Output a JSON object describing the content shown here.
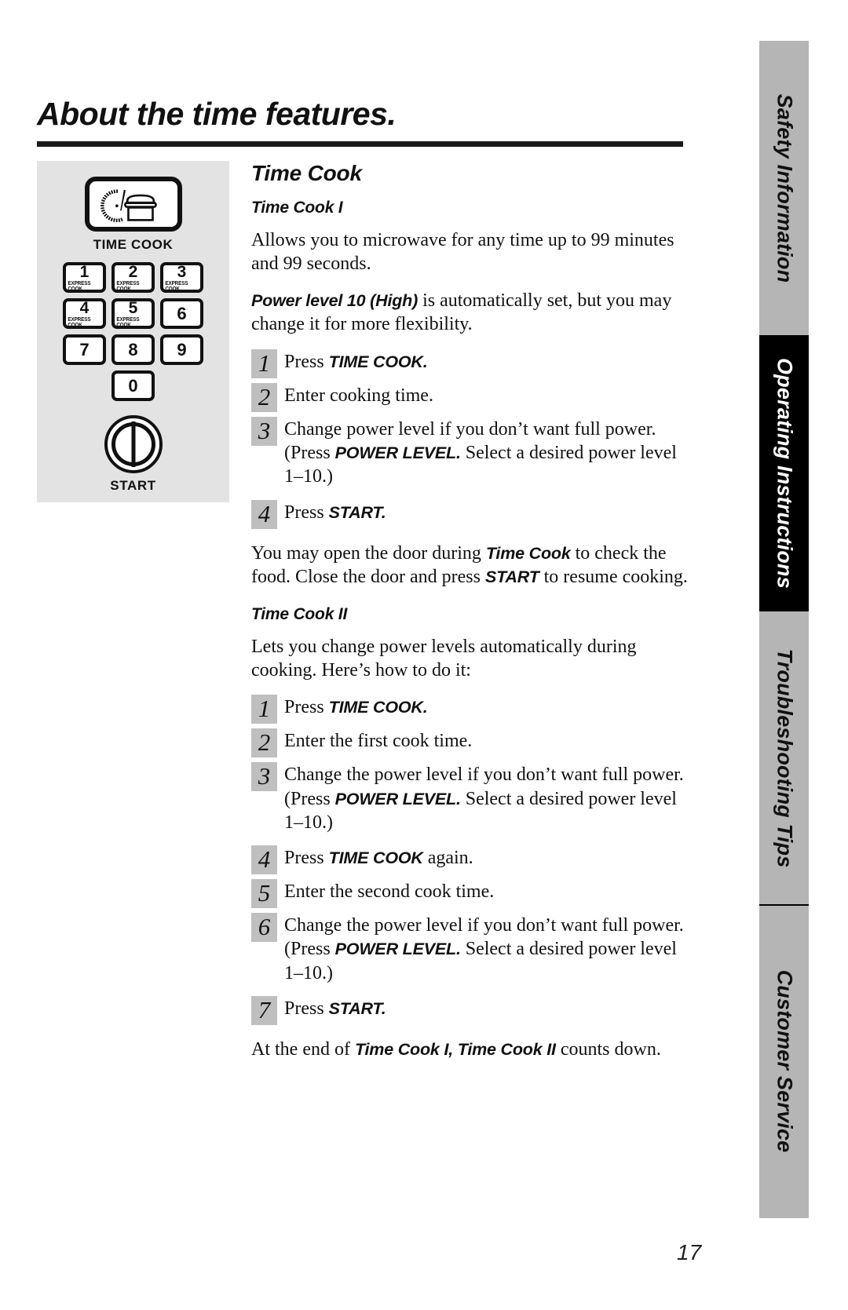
{
  "page": {
    "title": "About the time features.",
    "number": "17"
  },
  "sidebar": {
    "tabs": [
      {
        "label": "Safety Information",
        "active": false
      },
      {
        "label": "Operating Instructions",
        "active": true
      },
      {
        "label": "Troubleshooting Tips",
        "active": false
      },
      {
        "label": "Customer Service",
        "active": false
      }
    ]
  },
  "control_panel": {
    "time_cook_button": {
      "icon": "clock-casserole-icon",
      "caption": "TIME COOK"
    },
    "keys": [
      {
        "digit": "1",
        "sub": "EXPRESS COOK"
      },
      {
        "digit": "2",
        "sub": "EXPRESS COOK"
      },
      {
        "digit": "3",
        "sub": "EXPRESS COOK"
      },
      {
        "digit": "4",
        "sub": "EXPRESS COOK"
      },
      {
        "digit": "5",
        "sub": "EXPRESS COOK"
      },
      {
        "digit": "6",
        "sub": ""
      },
      {
        "digit": "7",
        "sub": ""
      },
      {
        "digit": "8",
        "sub": ""
      },
      {
        "digit": "9",
        "sub": ""
      }
    ],
    "zero_key": {
      "digit": "0",
      "sub": ""
    },
    "start_button": {
      "caption": "START",
      "icon": "power-start-icon"
    }
  },
  "content": {
    "section_title": "Time Cook",
    "time_cook_1": {
      "heading": "Time Cook I",
      "intro": "Allows you to microwave for any time up to 99 minutes and 99 seconds.",
      "power_note_bold": "Power level 10 (High)",
      "power_note_rest": " is automatically set, but you may change it for more flexibility.",
      "steps": [
        {
          "num": "1",
          "pre": "Press ",
          "bold": "TIME COOK.",
          "post": ""
        },
        {
          "num": "2",
          "pre": "Enter cooking time.",
          "bold": "",
          "post": ""
        },
        {
          "num": "3",
          "pre": "Change power level if you don’t want full power. (Press ",
          "bold": "POWER LEVEL.",
          "post": " Select a desired power level 1–10.)"
        },
        {
          "num": "4",
          "pre": "Press ",
          "bold": "START.",
          "post": ""
        }
      ],
      "note_part1": "You may open the door during ",
      "note_bold1": "Time Cook",
      "note_part2": " to check the food. Close the door and press ",
      "note_bold2": "START",
      "note_part3": " to resume cooking."
    },
    "time_cook_2": {
      "heading": "Time Cook II",
      "intro": "Lets you change power levels automatically during cooking. Here’s how to do it:",
      "steps": [
        {
          "num": "1",
          "pre": "Press ",
          "bold": "TIME COOK.",
          "post": ""
        },
        {
          "num": "2",
          "pre": "Enter the first cook time.",
          "bold": "",
          "post": ""
        },
        {
          "num": "3",
          "pre": "Change the power level if you don’t want full power. (Press ",
          "bold": "POWER LEVEL.",
          "post": " Select a desired power level 1–10.)"
        },
        {
          "num": "4",
          "pre": "Press ",
          "bold": "TIME COOK",
          "post": " again."
        },
        {
          "num": "5",
          "pre": "Enter the second cook time.",
          "bold": "",
          "post": ""
        },
        {
          "num": "6",
          "pre": "Change the power level if you don’t want full power. (Press ",
          "bold": "POWER LEVEL.",
          "post": " Select a desired power level 1–10.)"
        },
        {
          "num": "7",
          "pre": "Press ",
          "bold": "START.",
          "post": ""
        }
      ],
      "closing_part1": "At the end of ",
      "closing_bold": "Time Cook I, Time Cook II",
      "closing_part2": " counts down."
    }
  }
}
